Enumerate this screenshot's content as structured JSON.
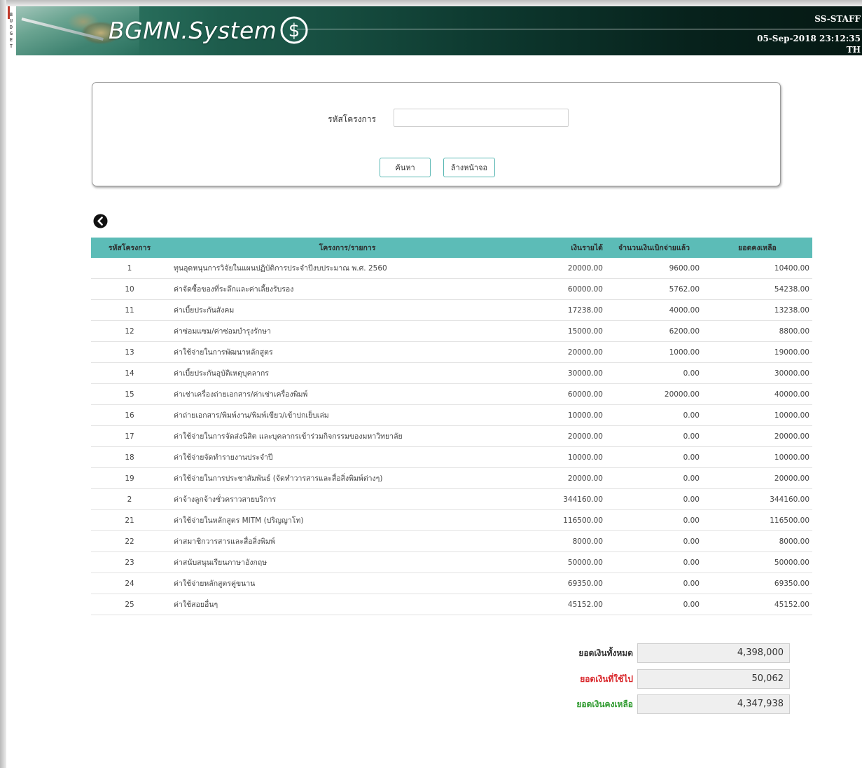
{
  "header": {
    "brand": "BGMN.System",
    "vertical_tag": [
      "B",
      "U",
      "D",
      "G",
      "E",
      "T"
    ],
    "user": "SS-STAFF",
    "datetime": "05-Sep-2018 23:12:35",
    "lang": "TH"
  },
  "search": {
    "label": "รหัสโครงการ",
    "input_value": "",
    "search_button": "ค้นหา",
    "clear_button": "ล้างหน้าจอ"
  },
  "table": {
    "headers": {
      "code": "รหัสโครงการ",
      "name": "โครงการ/รายการ",
      "income": "เงินรายได้",
      "paid": "จำนวนเงินเบิกจ่ายแล้ว",
      "balance": "ยอดคงเหลือ"
    },
    "rows": [
      {
        "code": "1",
        "name": "ทุนอุดหนุนการวิจัยในแผนปฏิบัติการประจำปีงบประมาณ พ.ศ. 2560",
        "income": "20000.00",
        "paid": "9600.00",
        "balance": "10400.00"
      },
      {
        "code": "10",
        "name": "ค่าจัดซื้อของที่ระลึกและค่าเลี้ยงรับรอง",
        "income": "60000.00",
        "paid": "5762.00",
        "balance": "54238.00"
      },
      {
        "code": "11",
        "name": "ค่าเบี้ยประกันสังคม",
        "income": "17238.00",
        "paid": "4000.00",
        "balance": "13238.00"
      },
      {
        "code": "12",
        "name": "ค่าซ่อมแซม/ค่าซ่อมบำรุงรักษา",
        "income": "15000.00",
        "paid": "6200.00",
        "balance": "8800.00"
      },
      {
        "code": "13",
        "name": "ค่าใช้จ่ายในการพัฒนาหลักสูตร",
        "income": "20000.00",
        "paid": "1000.00",
        "balance": "19000.00"
      },
      {
        "code": "14",
        "name": "ค่าเบี้ยประกันอุบัติเหตุบุคลากร",
        "income": "30000.00",
        "paid": "0.00",
        "balance": "30000.00"
      },
      {
        "code": "15",
        "name": "ค่าเช่าเครื่องถ่ายเอกสาร/ค่าเช่าเครื่องพิมพ์",
        "income": "60000.00",
        "paid": "20000.00",
        "balance": "40000.00"
      },
      {
        "code": "16",
        "name": "ค่าถ่ายเอกสาร/พิมพ์งาน/พิมพ์เขียว/เข้าปกเย็บเล่ม",
        "income": "10000.00",
        "paid": "0.00",
        "balance": "10000.00"
      },
      {
        "code": "17",
        "name": "ค่าใช้จ่ายในการจัดส่งนิสิต และบุคลากรเข้าร่วมกิจกรรมของมหาวิทยาลัย",
        "income": "20000.00",
        "paid": "0.00",
        "balance": "20000.00"
      },
      {
        "code": "18",
        "name": "ค่าใช้จ่ายจัดทำรายงานประจำปี",
        "income": "10000.00",
        "paid": "0.00",
        "balance": "10000.00"
      },
      {
        "code": "19",
        "name": "ค่าใช้จ่ายในการประชาสัมพันธ์ (จัดทำวารสารและสื่อสิ่งพิมพ์ต่างๆ)",
        "income": "20000.00",
        "paid": "0.00",
        "balance": "20000.00"
      },
      {
        "code": "2",
        "name": "ค่าจ้างลูกจ้างชั่วคราวสายบริการ",
        "income": "344160.00",
        "paid": "0.00",
        "balance": "344160.00"
      },
      {
        "code": "21",
        "name": "ค่าใช้จ่ายในหลักสูตร MITM (ปริญญาโท)",
        "income": "116500.00",
        "paid": "0.00",
        "balance": "116500.00"
      },
      {
        "code": "22",
        "name": "ค่าสมาชิกวารสารและสื่อสิ่งพิมพ์",
        "income": "8000.00",
        "paid": "0.00",
        "balance": "8000.00"
      },
      {
        "code": "23",
        "name": "ค่าสนับสนุนเรียนภาษาอังกฤษ",
        "income": "50000.00",
        "paid": "0.00",
        "balance": "50000.00"
      },
      {
        "code": "24",
        "name": "ค่าใช้จ่ายหลักสูตรคู่ขนาน",
        "income": "69350.00",
        "paid": "0.00",
        "balance": "69350.00"
      },
      {
        "code": "25",
        "name": "ค่าใช้สอยอื่นๆ",
        "income": "45152.00",
        "paid": "0.00",
        "balance": "45152.00"
      }
    ]
  },
  "summary": {
    "total_label": "ยอดเงินทั้งหมด",
    "total_value": "4,398,000",
    "used_label": "ยอดเงินที่ใช้ไป",
    "used_value": "50,062",
    "remaining_label": "ยอดเงินคงเหลือ",
    "remaining_value": "4,347,938"
  },
  "colors": {
    "table_header": "#5cbcb7",
    "used_label": "#d9262a",
    "remaining_label": "#2e9a2e",
    "total_label": "#333333"
  },
  "icons": {
    "back": "chevron-left-circle-icon",
    "brand": "dollar-circle-icon"
  }
}
